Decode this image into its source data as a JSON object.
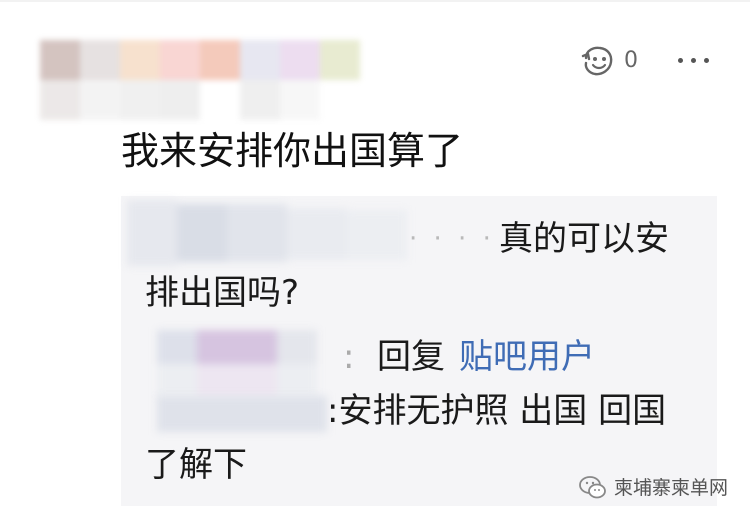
{
  "comment": {
    "reaction_count": "0",
    "text": "我来安排你出国算了"
  },
  "reply_1": {
    "dots": "· · · ·",
    "text_line1": "真的可以安",
    "text_line2": "排出国吗?"
  },
  "reply_2": {
    "separator": ":",
    "reply_word": "回复",
    "mention": "贴吧用户",
    "text_line1": ":安排无护照 出国 回国",
    "text_line2": "了解下"
  },
  "watermark": {
    "text": "柬埔寨柬单网",
    "icon": "wechat-icon"
  },
  "colors": {
    "link": "#3f6cb5",
    "reply_bg": "#f5f5f7",
    "text": "#111111"
  }
}
